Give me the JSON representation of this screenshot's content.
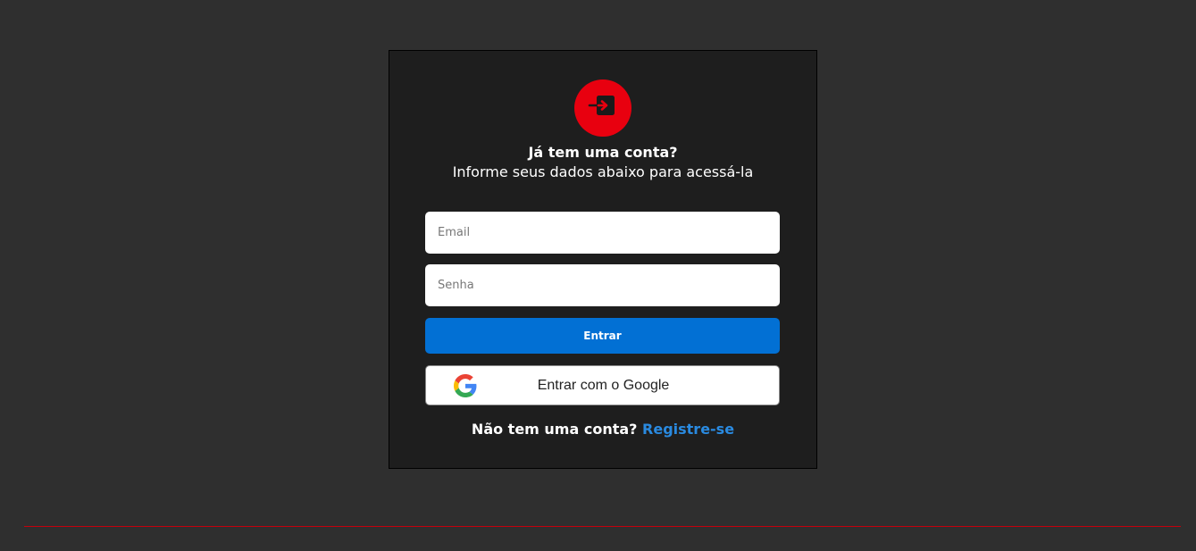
{
  "login_card": {
    "heading": "Já tem uma conta?",
    "subheading": "Informe seus dados abaixo para acessá-la",
    "email_placeholder": "Email",
    "email_value": "",
    "password_placeholder": "Senha",
    "password_value": "",
    "submit_label": "Entrar",
    "google_label": "Entrar com o Google",
    "register_prompt": "Não tem uma conta?",
    "register_link": "Registre-se"
  },
  "icons": {
    "logo": "login-arrow-icon",
    "google": "google-icon"
  },
  "colors": {
    "background": "#2f2f2f",
    "card": "#1e1e1e",
    "accent_red": "#e8000f",
    "primary_blue": "#0270d4",
    "link_blue": "#2a8ae0",
    "footer_line": "#c4000c"
  }
}
